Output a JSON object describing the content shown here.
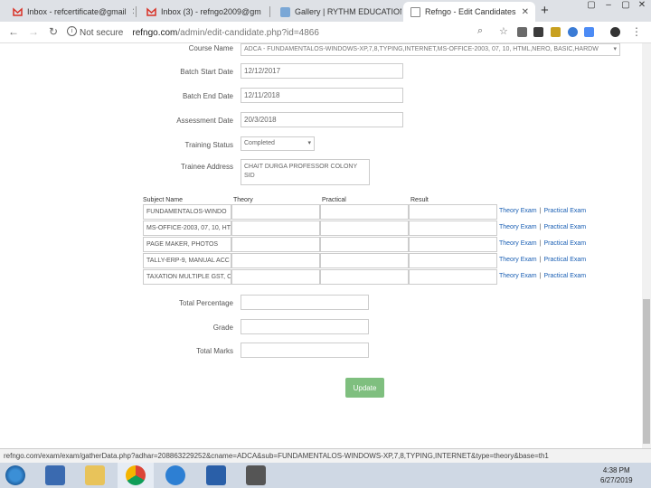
{
  "browser": {
    "tabs": [
      {
        "title": "Inbox - refcertificate@gmail",
        "icon": "gmail-icon",
        "active": false
      },
      {
        "title": "Inbox (3) - refngo2009@gm",
        "icon": "gmail-icon",
        "active": false
      },
      {
        "title": "Gallery | RYTHM EDUCATION",
        "icon": "gallery-icon",
        "active": false
      },
      {
        "title": "Refngo - Edit Candidates",
        "icon": "page-icon",
        "active": true
      }
    ],
    "new_tab": "+",
    "address": {
      "security": "Not secure",
      "host": "refngo.com",
      "path": "/admin/edit-candidate.php?id=4866"
    },
    "status_url": "refngo.com/exam/exam/gatherData.php?adhar=208863229252&cname=ADCA&sub=FUNDAMENTALOS-WINDOWS-XP,7,8,TYPING,INTERNET&type=theory&base=th1"
  },
  "form": {
    "course": {
      "label": "Course Name",
      "value": "ADCA - FUNDAMENTALOS-WINDOWS-XP,7,8,TYPING,INTERNET,MS-OFFICE-2003, 07, 10, HTML,NERO, BASIC,HARDW"
    },
    "batch_start": {
      "label": "Batch Start Date",
      "value": "12/12/2017"
    },
    "batch_end": {
      "label": "Batch End Date",
      "value": "12/11/2018"
    },
    "assessment": {
      "label": "Assessment Date",
      "value": "20/3/2018"
    },
    "training_status": {
      "label": "Training Status",
      "value": "Completed"
    },
    "trainee_address": {
      "label": "Trainee Address",
      "value": "CHAIT DURGA PROFESSOR COLONY SID"
    },
    "total_percentage": {
      "label": "Total Percentage",
      "value": ""
    },
    "grade": {
      "label": "Grade",
      "value": ""
    },
    "total_marks": {
      "label": "Total Marks",
      "value": ""
    },
    "update_label": "Update"
  },
  "subjects": {
    "headers": {
      "subject": "Subject Name",
      "theory": "Theory",
      "practical": "Practical",
      "result": "Result"
    },
    "theory_link": "Theory Exam",
    "practical_link": "Practical Exam",
    "separator": "|",
    "rows": [
      {
        "name": "FUNDAMENTALOS-WINDO",
        "theory": "",
        "practical": "",
        "result": ""
      },
      {
        "name": "MS-OFFICE-2003, 07, 10, HT",
        "theory": "",
        "practical": "",
        "result": ""
      },
      {
        "name": "PAGE MAKER, PHOTOS",
        "theory": "",
        "practical": "",
        "result": ""
      },
      {
        "name": "TALLY-ERP-9, MANUAL ACC",
        "theory": "",
        "practical": "",
        "result": ""
      },
      {
        "name": "TAXATION MULTIPLE GST, C",
        "theory": "",
        "practical": "",
        "result": ""
      }
    ]
  },
  "taskbar": {
    "time": "4:38 PM",
    "date": "6/27/2019"
  },
  "colors": {
    "link": "#1a5fb4",
    "update_button": "#7fbf7f",
    "taskbar": "#cfd8e4"
  }
}
